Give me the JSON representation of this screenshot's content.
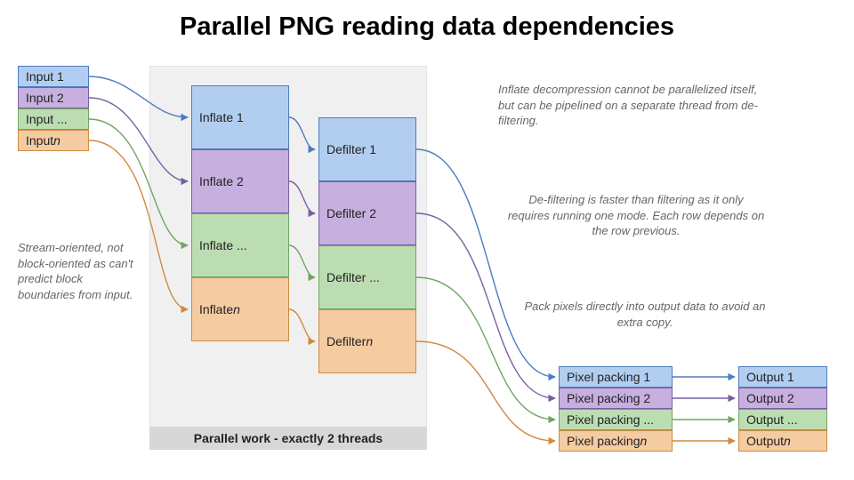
{
  "title": "Parallel PNG reading data dependencies",
  "inputs": {
    "i1": "Input 1",
    "i2": "Input 2",
    "i3": "Input ...",
    "in": "Input n"
  },
  "inflate": {
    "f1": "Inflate 1",
    "f2": "Inflate 2",
    "f3": "Inflate ...",
    "fn": "Inflate n"
  },
  "defilter": {
    "d1": "Defilter 1",
    "d2": "Defilter 2",
    "d3": "Defilter ...",
    "dn": "Defilter n"
  },
  "pixelpack": {
    "p1": "Pixel packing 1",
    "p2": "Pixel packing 2",
    "p3": "Pixel packing ...",
    "pn": "Pixel packing n"
  },
  "outputs": {
    "o1": "Output 1",
    "o2": "Output 2",
    "o3": "Output ...",
    "on": "Output n"
  },
  "parallel_label": "Parallel work - exactly 2 threads",
  "notes": {
    "stream": "Stream-oriented, not block-oriented as can't predict block boundaries from input.",
    "inflate": "Inflate decompression cannot be parallelized itself, but can be pipelined on a separate thread from de-filtering.",
    "defilter": "De-filtering is faster than filtering as it only requires running one mode. Each row depends on the row previous.",
    "pack": "Pack pixels directly into output data to avoid an extra copy."
  },
  "colors": {
    "blue": "#4b7dbf",
    "purple": "#7a5fa3",
    "green": "#6fa662",
    "orange": "#cf8b3f"
  }
}
